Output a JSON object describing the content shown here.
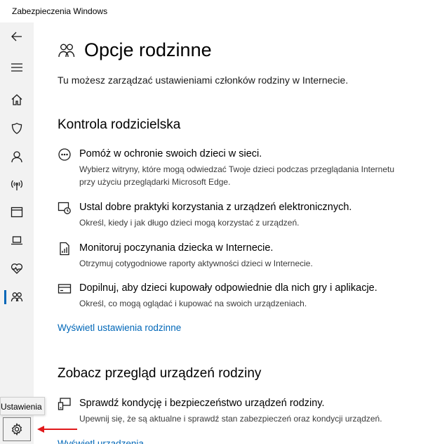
{
  "window": {
    "title": "Zabezpieczenia Windows"
  },
  "sidebar": {
    "items": [
      {
        "name": "back-icon"
      },
      {
        "name": "menu-icon"
      },
      {
        "name": "home-icon"
      },
      {
        "name": "shield-icon"
      },
      {
        "name": "account-icon"
      },
      {
        "name": "network-icon"
      },
      {
        "name": "app-browser-icon"
      },
      {
        "name": "device-security-icon"
      },
      {
        "name": "health-icon"
      },
      {
        "name": "family-icon",
        "active": true
      }
    ],
    "settings_tooltip": "Ustawienia"
  },
  "page": {
    "title": "Opcje rodzinne",
    "subtitle": "Tu możesz zarządzać ustawieniami członków rodziny w Internecie."
  },
  "parental": {
    "heading": "Kontrola rodzicielska",
    "items": [
      {
        "title": "Pomóż w ochronie swoich dzieci w sieci.",
        "desc": "Wybierz witryny, które mogą odwiedzać Twoje dzieci podczas przeglądania Internetu przy użyciu przeglądarki Microsoft Edge."
      },
      {
        "title": "Ustal dobre praktyki korzystania z urządzeń elektronicznych.",
        "desc": "Określ, kiedy i jak długo dzieci mogą korzystać z urządzeń."
      },
      {
        "title": "Monitoruj poczynania dziecka w Internecie.",
        "desc": "Otrzymuj cotygodniowe raporty aktywności dzieci w Internecie."
      },
      {
        "title": "Dopilnuj, aby dzieci kupowały odpowiednie dla nich gry i aplikacje.",
        "desc": "Określ, co mogą oglądać i kupować na swoich urządzeniach."
      }
    ],
    "link": "Wyświetl ustawienia rodzinne"
  },
  "devices": {
    "heading": "Zobacz przegląd urządzeń rodziny",
    "item": {
      "title": "Sprawdź kondycję i bezpieczeństwo urządzeń rodziny.",
      "desc": "Upewnij się, że są aktualne i sprawdź stan zabezpieczeń oraz kondycji urządzeń."
    },
    "link": "Wyświetl urządzenia"
  },
  "colors": {
    "accent": "#0067b8",
    "annotation_arrow": "#e0191b"
  }
}
